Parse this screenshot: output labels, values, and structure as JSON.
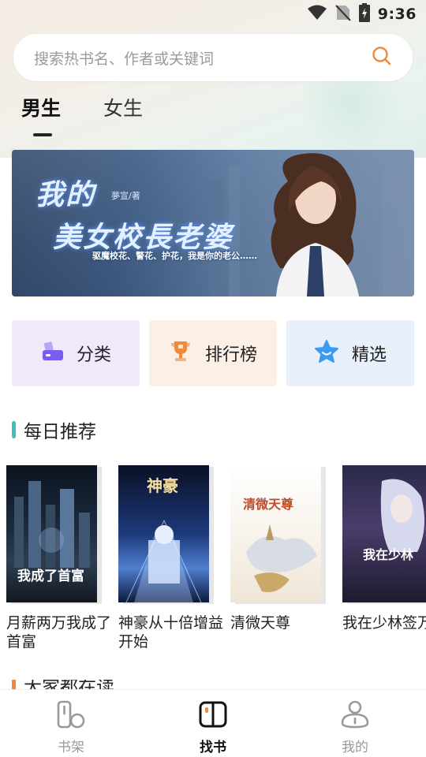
{
  "status_bar": {
    "time": "9:36"
  },
  "search": {
    "placeholder": "搜索热书名、作者或关键词"
  },
  "tabs": [
    {
      "label": "男生",
      "active": true
    },
    {
      "label": "女生",
      "active": false
    }
  ],
  "banner": {
    "title_line1": "我的",
    "title_line2": "美女校長老婆",
    "author": "夢宣/著",
    "tagline": "驱魔校花、警花、护花，我是你的老公……"
  },
  "quick_links": [
    {
      "label": "分类",
      "icon": "category-icon",
      "color": "#7b5cf0"
    },
    {
      "label": "排行榜",
      "icon": "trophy-icon",
      "color": "#f08a3c"
    },
    {
      "label": "精选",
      "icon": "star-icon",
      "color": "#3a9cf0"
    }
  ],
  "daily": {
    "title": "每日推荐",
    "accent": "#3fc2b6",
    "books": [
      {
        "name": "月薪两万我成了首富",
        "cover_text": "我成了首富"
      },
      {
        "name": "神豪从十倍增益开始",
        "cover_text": "神豪"
      },
      {
        "name": "清微天尊",
        "cover_text": "清微天尊"
      },
      {
        "name": "我在少林签万年",
        "cover_text": "我在少林"
      }
    ]
  },
  "next_section": {
    "title": "大家都在读",
    "accent": "#f08a3c"
  },
  "bottom_nav": [
    {
      "label": "书架",
      "icon": "bookshelf-icon",
      "active": false
    },
    {
      "label": "找书",
      "icon": "find-book-icon",
      "active": true
    },
    {
      "label": "我的",
      "icon": "profile-icon",
      "active": false
    }
  ]
}
